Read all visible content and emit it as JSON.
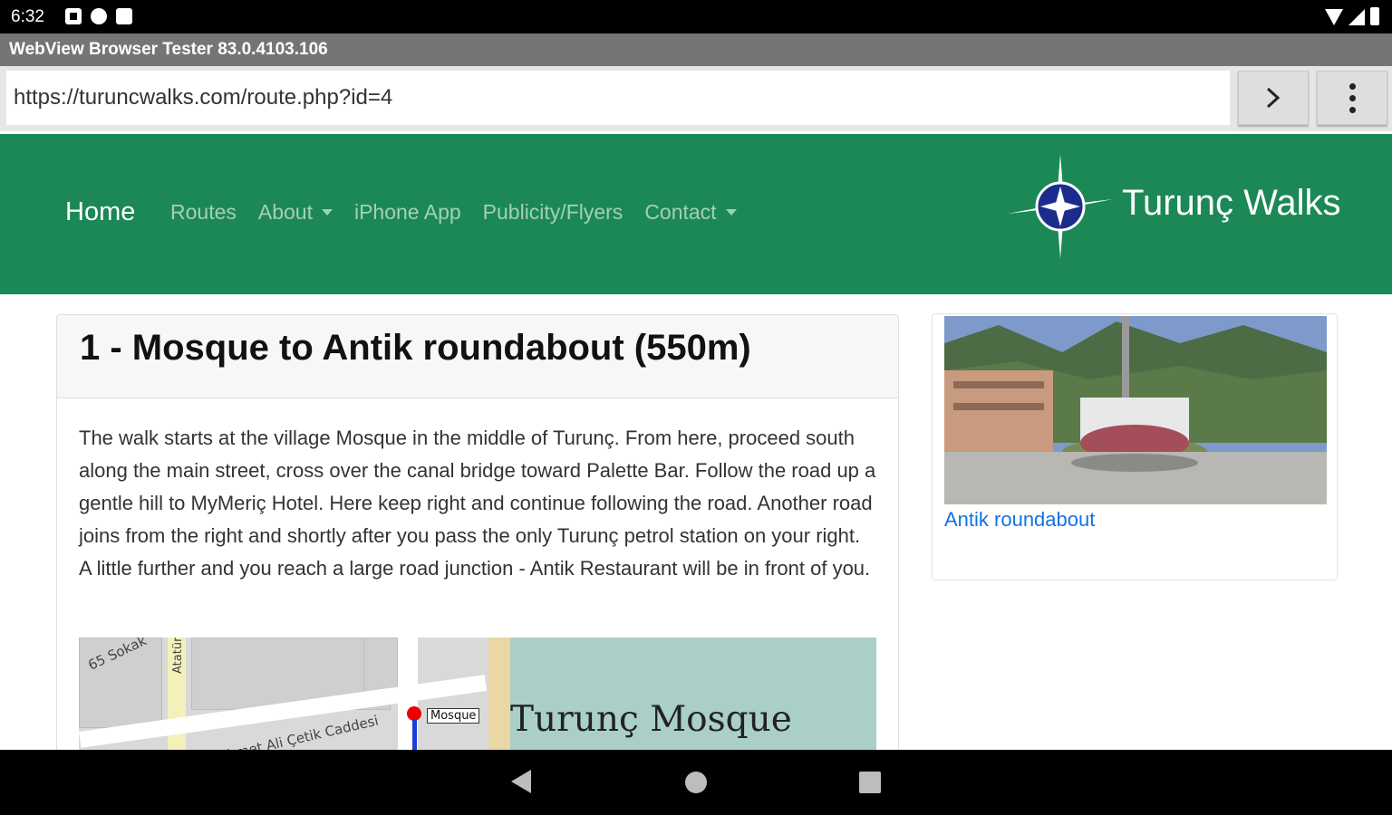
{
  "status_bar": {
    "time": "6:32"
  },
  "app_title": "WebView Browser Tester 83.0.4103.106",
  "url_bar": {
    "url": "https://turuncwalks.com/route.php?id=4"
  },
  "navbar": {
    "home_label": "Home",
    "items": [
      {
        "label": "Routes",
        "has_dropdown": false
      },
      {
        "label": "About",
        "has_dropdown": true
      },
      {
        "label": "iPhone App",
        "has_dropdown": false
      },
      {
        "label": "Publicity/Flyers",
        "has_dropdown": false
      },
      {
        "label": "Contact",
        "has_dropdown": true
      }
    ],
    "site_title": "Turunç Walks",
    "background_color": "#1b8855"
  },
  "main": {
    "title": "1 - Mosque to Antik roundabout (550m)",
    "text": "The walk starts at the village Mosque in the middle of Turunç. From here, proceed south along the main street, cross over the canal bridge toward Palette Bar. Follow the road up a gentle hill to MyMeriç Hotel. Here keep right and continue following the road. Another road joins from the right and shortly after you pass the only Turunç petrol station on your right. A little further and you reach a large road junction - Antik Restaurant will be in front of you.",
    "map": {
      "street_sokak": "65 Sokak",
      "street_ataturk": "Atatürk C",
      "street_mehmet": "Mehmet Ali Çetik Caddesi",
      "marker_label": "Mosque",
      "place_title": "Turunç Mosque"
    }
  },
  "side": {
    "photo_caption": "Antik roundabout",
    "link_color": "#1273e6"
  }
}
